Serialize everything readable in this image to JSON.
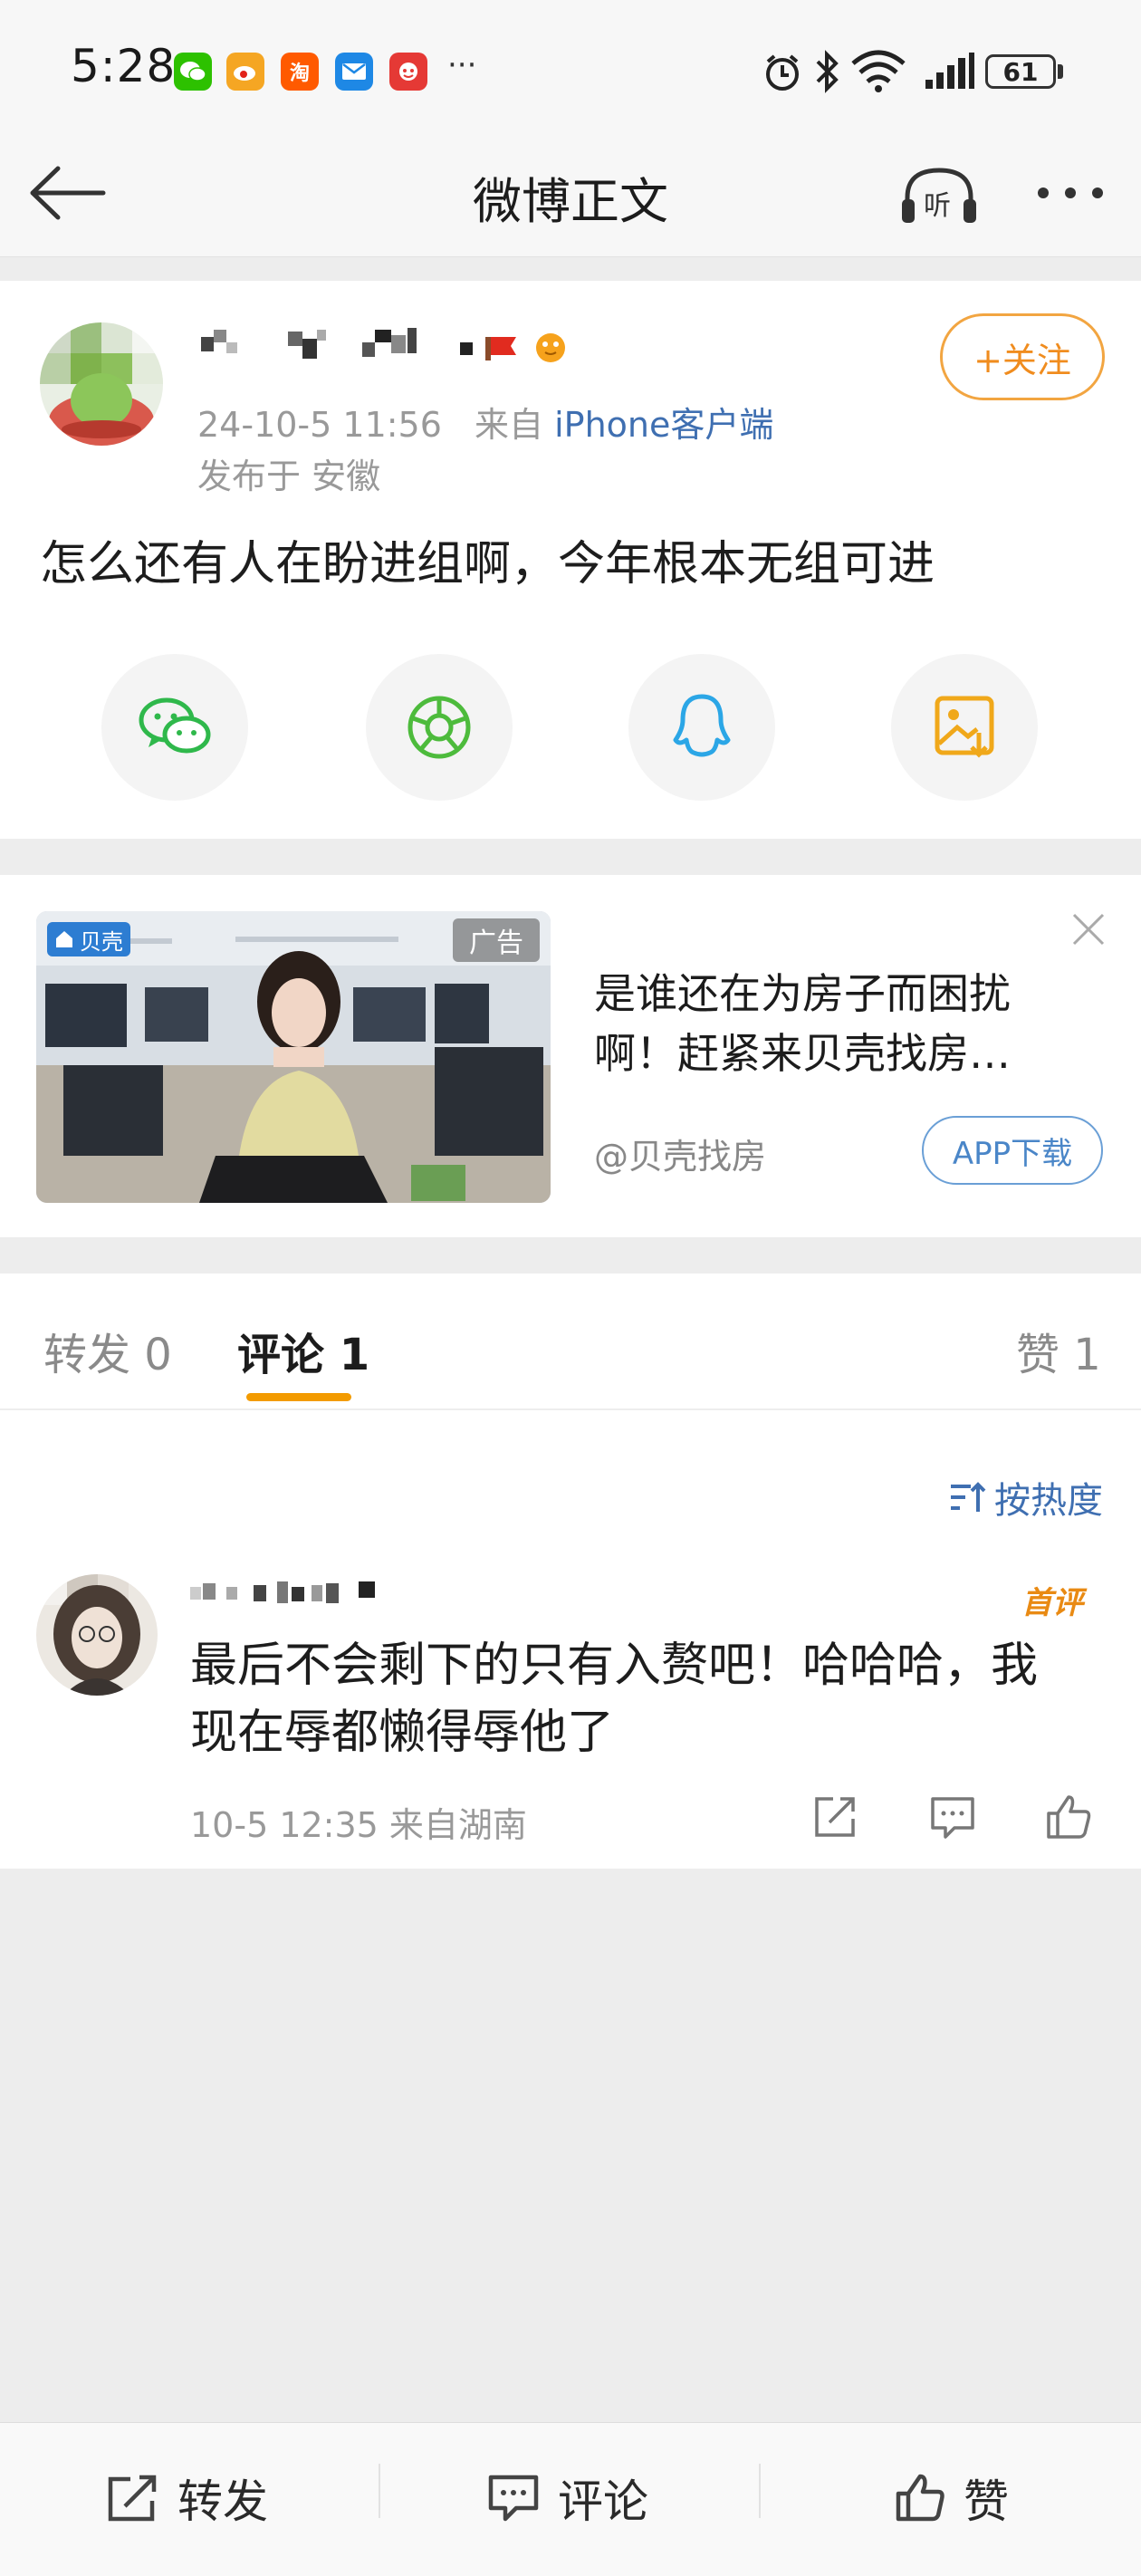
{
  "status_bar": {
    "time": "5:28",
    "app_icons": [
      {
        "name": "wechat-icon",
        "glyph": "",
        "color": "#2dc100"
      },
      {
        "name": "weibo-icon",
        "glyph": "",
        "color": "#f5a623"
      },
      {
        "name": "taobao-icon",
        "glyph": "淘",
        "color": "#ff5a00"
      },
      {
        "name": "mail-icon",
        "glyph": "",
        "color": "#1e88e5"
      },
      {
        "name": "xiaohongshu-icon",
        "glyph": "",
        "color": "#e53935"
      }
    ],
    "more": "···",
    "battery": "61"
  },
  "nav": {
    "title": "微博正文",
    "listen_label": "听"
  },
  "post": {
    "follow_label": "+关注",
    "time": "24-10-5 11:56",
    "source_prefix": "来自",
    "source": "iPhone客户端",
    "location": "发布于 安徽",
    "text": "怎么还有人在盼进组啊，今年根本无组可进"
  },
  "ad": {
    "tag": "广告",
    "brand": "贝壳",
    "text": "是谁还在为房子而困扰啊！赶紧来贝壳找房…",
    "source": "@贝壳找房",
    "button": "APP下载"
  },
  "tabs": {
    "repost": "转发 0",
    "comment": "评论 1",
    "like": "赞 1"
  },
  "comments": {
    "sort_label": "按热度",
    "items": [
      {
        "badge": "首评",
        "text": "最后不会剩下的只有入赘吧！哈哈哈，我现在辱都懒得辱他了",
        "meta": "10-5 12:35  来自湖南"
      }
    ]
  },
  "bottom_bar": {
    "repost": "转发",
    "comment": "评论",
    "like": "赞"
  },
  "colors": {
    "accent_orange": "#f39b00",
    "link_blue": "#3f6fb1",
    "follow_orange": "#f08c1e"
  }
}
